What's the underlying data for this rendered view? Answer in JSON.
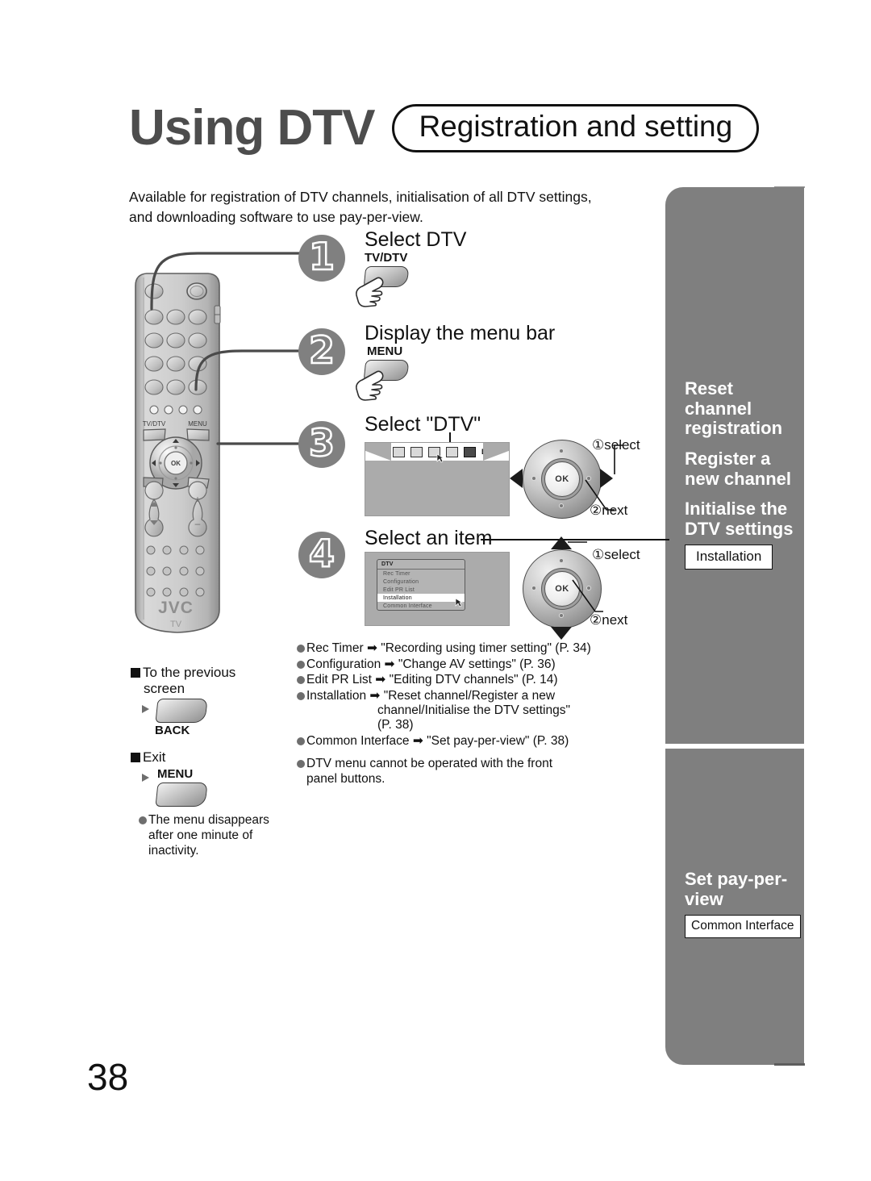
{
  "header": {
    "title": "Using DTV",
    "pill": "Registration and setting",
    "intro": "Available for registration of DTV channels, initialisation of all DTV settings, and downloading software to use pay-per-view."
  },
  "steps": [
    {
      "num": "1",
      "title": "Select DTV",
      "key": "TV/DTV"
    },
    {
      "num": "2",
      "title": "Display the menu bar",
      "key": "MENU"
    },
    {
      "num": "3",
      "title": "Select \"DTV\""
    },
    {
      "num": "4",
      "title": "Select an item"
    }
  ],
  "menu_bar": {
    "label": "DTV",
    "icons": [
      "picture-icon",
      "sound-icon",
      "feature-icon",
      "setup-icon",
      "dtv-icon"
    ]
  },
  "dtv_menu": {
    "title": "DTV",
    "items": [
      "Rec Timer",
      "Configuration",
      "Edit PR List",
      "Installation",
      "Common Interface"
    ],
    "selected": "Installation"
  },
  "wheel": {
    "ok": "OK",
    "select": "①select",
    "next": "②next"
  },
  "item_links": [
    {
      "name": "Rec Timer",
      "target": "\"Recording using timer setting\" (P. 34)",
      "cont": ""
    },
    {
      "name": "Configuration",
      "target": "\"Change AV settings\" (P. 36)",
      "cont": ""
    },
    {
      "name": "Edit PR List",
      "target": "\"Editing DTV channels\" (P. 14)",
      "cont": ""
    },
    {
      "name": "Installation",
      "target": "\"Reset channel/Register a new",
      "cont": "channel/Initialise the DTV settings\"",
      "cont2": "(P. 38)"
    },
    {
      "name": "Common Interface",
      "target": "\"Set pay-per-view\" (P. 38)",
      "cont": ""
    }
  ],
  "note_front_panel": "DTV menu cannot be operated with the front panel buttons.",
  "left_notes": {
    "back_heading_l1": "To the previous",
    "back_heading_l2": "screen",
    "back_key": "BACK",
    "exit_heading": "Exit",
    "exit_key": "MENU",
    "exit_note": "The menu disappears after one minute of inactivity."
  },
  "side_panel": {
    "section_a": {
      "headings": [
        "Reset\nchannel\nregistration",
        "Register a\nnew channel",
        "Initialise the\nDTV settings"
      ],
      "heading1": "Reset channel registration",
      "heading2": "Register a new channel",
      "heading3": "Initialise the DTV settings",
      "chip": "Installation"
    },
    "section_b": {
      "heading": "Set pay-per-view",
      "chip": "Common Interface"
    }
  },
  "remote": {
    "brand": "JVC",
    "sub": "TV",
    "keys": [
      "TV/DTV",
      "MENU",
      "BACK"
    ],
    "ok": "OK"
  },
  "page_number": "38",
  "colors": {
    "panel_grey": "#7f7f7f",
    "title_grey": "#4d4d4d",
    "screen_grey": "#ababab"
  }
}
